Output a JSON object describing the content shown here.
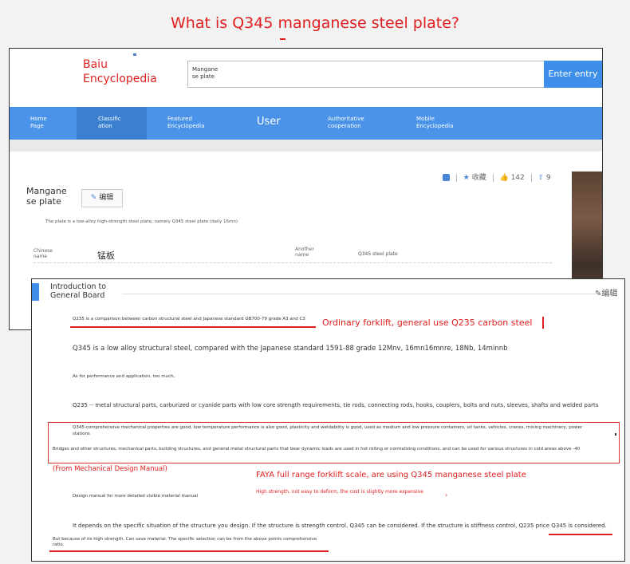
{
  "page_title": "What is Q345 manganese steel plate?",
  "site": {
    "logo_line1": "Baiu",
    "logo_line2": "Encyclopedia",
    "search_value_line1": "Mangane",
    "search_value_line2": "se plate",
    "search_button": "Enter entry"
  },
  "nav": {
    "home_1": "Home",
    "home_2": "Page",
    "classification_1": "Classific",
    "classification_2": "ation",
    "featured_1": "Featured",
    "featured_2": "Encyclopedia",
    "user": "User",
    "authoritative_1": "Authoritative",
    "authoritative_2": "cooperation",
    "mobile_1": "Mobile",
    "mobile_2": "Encyclopedia"
  },
  "lemma": {
    "title_line1": "Mangane",
    "title_line2": "se plate",
    "edit_label": "编辑",
    "collect_label": "收藏",
    "likes": "142",
    "shares": "9",
    "summary": "The plate is a low-alloy high-strength steel plate, namely Q345 steel plate (daily 16mn)",
    "info_label_1": "Chinese",
    "info_label_2": "name",
    "info_value": "锰板",
    "alias_label_1": "Another",
    "alias_label_2": "name",
    "alias_value": "Q345 steel plate"
  },
  "section": {
    "title_line1": "Introduction to",
    "title_line2": "General Board",
    "edit_label": "编辑",
    "p1": "Q235 is a comparison between carbon structural steel and Japanese standard GB700-79 grade A3 and C3",
    "p1_note": "Ordinary forklift, general use Q235 carbon steel",
    "p2": "Q345 is a low alloy structural steel, compared with the Japanese standard 1591-88 grade 12Mnv, 16mn16mnre, 18Nb, 14minnb",
    "p3": "As for performance and application, too much,",
    "p4": "Q235 -- metal structural parts, carburized or cyanide parts with low core strength requirements, tie rods, connecting rods, hooks, couplers, bolts and nuts, sleeves, shafts and welded parts",
    "p5a": "Q345-comprehensive mechanical properties are good, low temperature performance is also good, plasticity and weldability is good, used as medium and low pressure containers, oil tanks, vehicles, cranes, mining machinery, power",
    "p5b": "stations",
    "p5c": "Bridges and other structures, mechanical parts, building structures, and general metal structural parts that bear dynamic loads are used in hot rolling or normalizing conditions, and can be used for various structures in cold areas above -40",
    "source": "(From Mechanical Design Manual)",
    "note2": "FAYA full range forklift scale, are using Q345 manganese steel plate",
    "p6": "Design manual for more detailed visible material manual",
    "note3": "High strength, not easy to deform, the cost is slightly more expensive",
    "p7": "It depends on the specific situation of the structure you design. If the structure is strength control, Q345 can be considered. If the structure is stiffness control, Q235 price Q345 is considered.",
    "p8a": "But because of its high strength. Can save material. The specific selection can be from the above points comprehensive",
    "p8b": "ratio."
  },
  "colors": {
    "accent_red": "#e0201f",
    "nav_blue": "#4a93e8",
    "button_blue": "#3d8fea"
  }
}
